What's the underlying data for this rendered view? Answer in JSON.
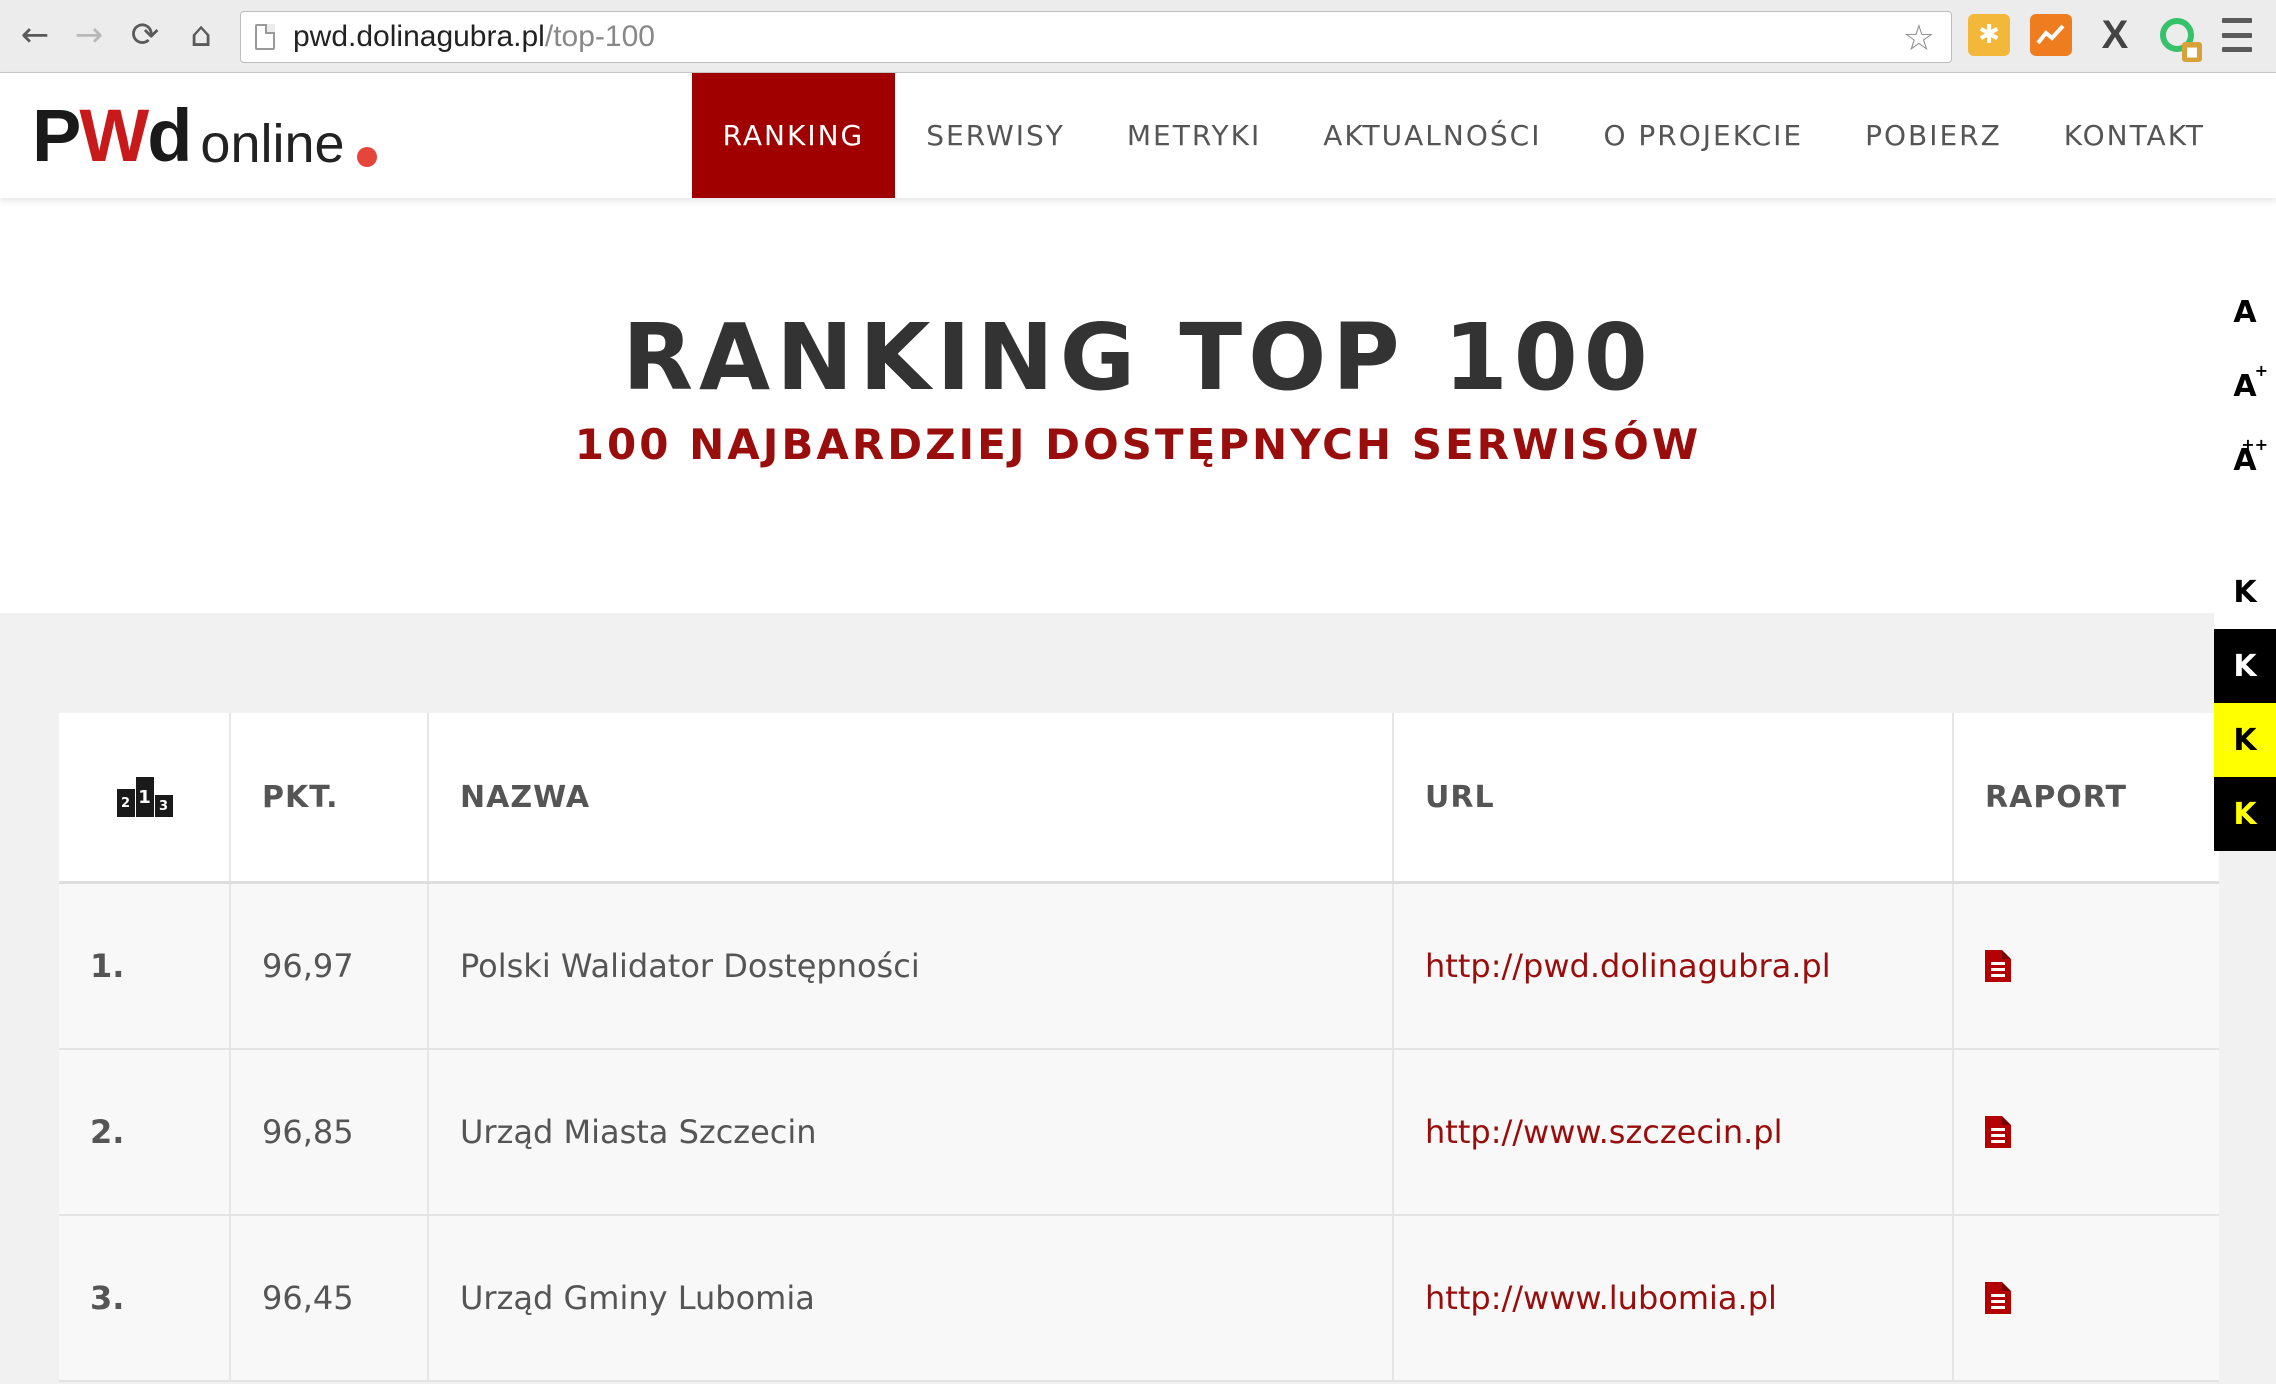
{
  "browser": {
    "url_host": "pwd.dolinagubra.pl",
    "url_path": "/top-100",
    "back_icon": "arrow-left-icon",
    "forward_icon": "arrow-right-icon",
    "reload_icon": "reload-icon",
    "home_icon": "home-icon",
    "extensions": [
      "puzzle-extension-icon",
      "chart-extension-icon",
      "x-extension-icon",
      "ring-extension-icon"
    ],
    "ext_x_label": "X"
  },
  "site": {
    "logo": {
      "pwd": "PWd",
      "online": "online"
    },
    "nav": [
      {
        "label": "RANKING",
        "active": true
      },
      {
        "label": "SERWISY",
        "active": false
      },
      {
        "label": "METRYKI",
        "active": false
      },
      {
        "label": "AKTUALNOŚCI",
        "active": false
      },
      {
        "label": "O PROJEKCIE",
        "active": false
      },
      {
        "label": "POBIERZ",
        "active": false
      },
      {
        "label": "KONTAKT",
        "active": false
      }
    ]
  },
  "hero": {
    "title": "RANKING TOP 100",
    "subtitle": "100 NAJBARDZIEJ DOSTĘPNYCH SERWISÓW"
  },
  "accessibility": {
    "font_sizes": [
      {
        "label": "A",
        "sup": ""
      },
      {
        "label": "A",
        "sup": "+"
      },
      {
        "label": "A",
        "sup": "++"
      }
    ],
    "contrasts": [
      "K",
      "K",
      "K",
      "K"
    ]
  },
  "table": {
    "headers": {
      "rank_icon": "podium-icon",
      "points": "PKT.",
      "name": "NAZWA",
      "url": "URL",
      "report": "RAPORT"
    },
    "podium_digits": [
      "2",
      "1",
      "3"
    ],
    "rows": [
      {
        "rank": "1.",
        "points": "96,97",
        "name": "Polski Walidator Dostępności",
        "url": "http://pwd.dolinagubra.pl"
      },
      {
        "rank": "2.",
        "points": "96,85",
        "name": "Urząd Miasta Szczecin",
        "url": "http://www.szczecin.pl"
      },
      {
        "rank": "3.",
        "points": "96,45",
        "name": "Urząd Gminy Lubomia",
        "url": "http://www.lubomia.pl"
      }
    ]
  },
  "colors": {
    "accent": "#a00000",
    "link": "#9a0d0d",
    "contrast_yellow": "#ffff00"
  }
}
